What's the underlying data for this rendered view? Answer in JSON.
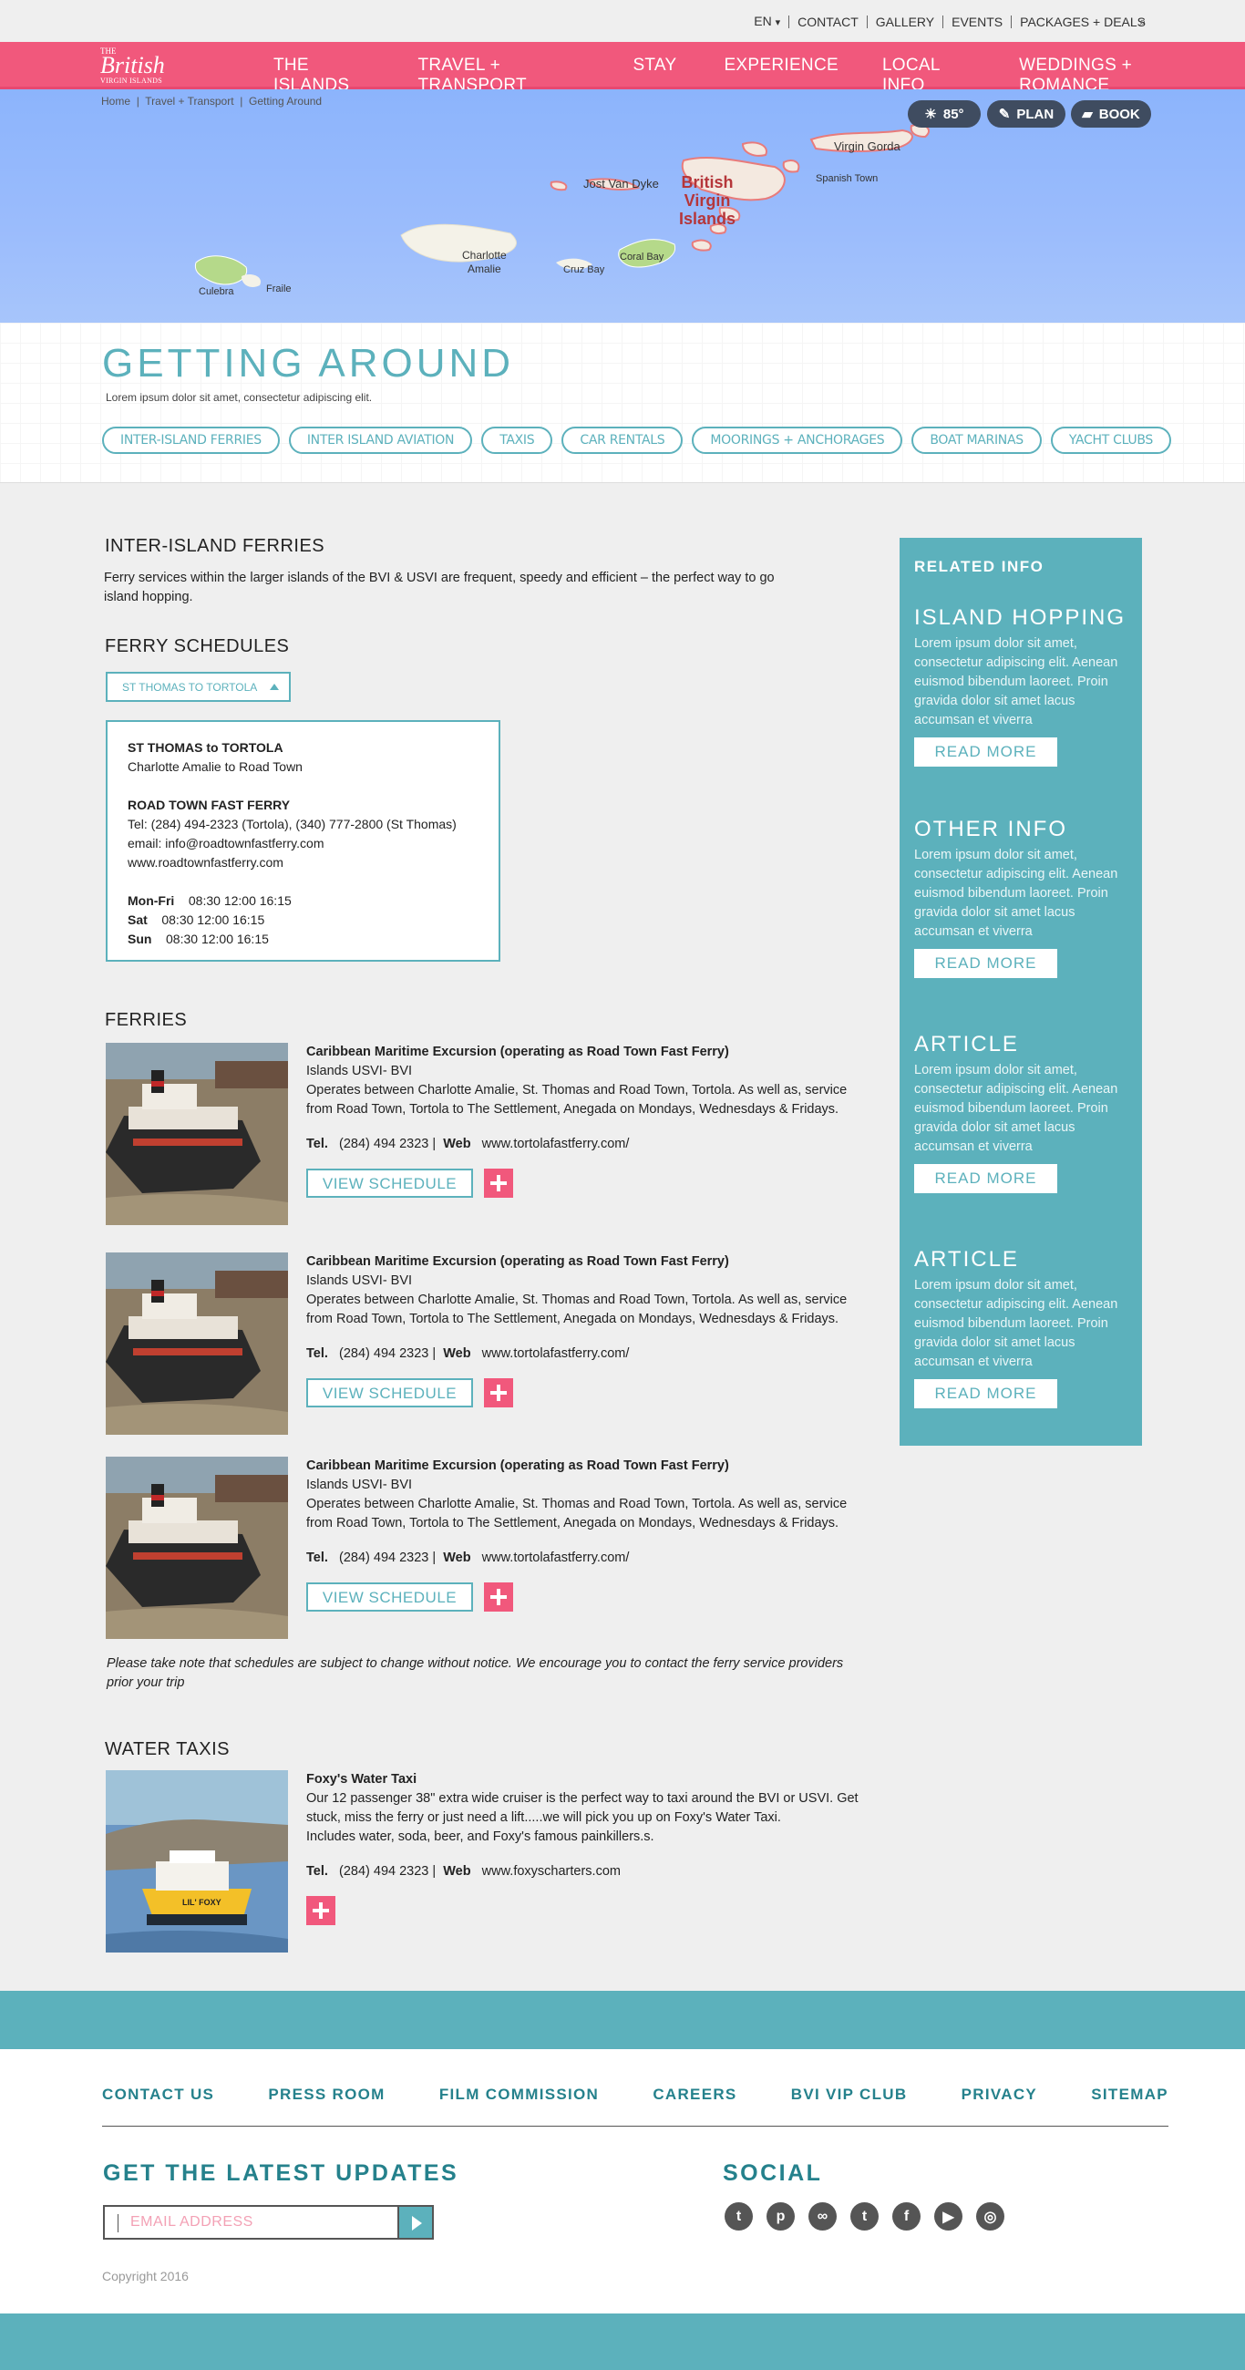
{
  "topbar": {
    "links": [
      "EN",
      "CONTACT",
      "GALLERY",
      "EVENTS",
      "PACKAGES + DEALS"
    ],
    "lang_caret": "▾",
    "search_icon": "search-icon",
    "search_glyph": "⌕"
  },
  "logo": {
    "small": "THE",
    "big": "British",
    "sub": "VIRGIN ISLANDS"
  },
  "nav": [
    "THE ISLANDS",
    "TRAVEL + TRANSPORT",
    "STAY",
    "EXPERIENCE",
    "LOCAL INFO",
    "WEDDINGS + ROMANCE"
  ],
  "breadcrumb": [
    "Home",
    "Travel + Transport",
    "Getting Around"
  ],
  "actions": {
    "weather": "85°",
    "plan": "PLAN",
    "book": "BOOK",
    "sun_glyph": "☀",
    "pen_glyph": "✎",
    "bag_glyph": "▰"
  },
  "map_labels": {
    "jost": "Jost Van Dyke",
    "bvi1": "British",
    "bvi2": "Virgin",
    "bvi3": "Islands",
    "gorda": "Virgin Gorda",
    "spanish": "Spanish Town",
    "charlotte1": "Charlotte",
    "charlotte2": "Amalie",
    "cruz": "Cruz Bay",
    "coral": "Coral Bay",
    "culebra": "Culebra",
    "fraile": "Fraile"
  },
  "hero": {
    "title": "GETTING AROUND",
    "lead": "Lorem ipsum dolor sit amet, consectetur adipiscing elit.",
    "tabs": [
      "INTER-ISLAND FERRIES",
      "INTER ISLAND AVIATION",
      "TAXIS",
      "CAR RENTALS",
      "MOORINGS + ANCHORAGES",
      "BOAT MARINAS",
      "YACHT CLUBS"
    ]
  },
  "ferries_intro": {
    "title": "INTER-ISLAND FERRIES",
    "text": "Ferry services within the larger islands of the BVI & USVI are frequent, speedy and efficient – the perfect way to go island hopping."
  },
  "schedules": {
    "title": "FERRY SCHEDULES",
    "dropdown": "ST THOMAS TO TORTOLA",
    "route_title": "ST THOMAS to TORTOLA",
    "route_sub": "Charlotte Amalie to Road Town",
    "company": "ROAD TOWN FAST FERRY",
    "tel": "Tel: (284) 494-2323 (Tortola), (340) 777-2800 (St Thomas)",
    "email": "email: info@roadtownfastferry.com",
    "web": "www.roadtownfastferry.com",
    "rows": [
      {
        "day": "Mon-Fri",
        "times": "08:30   12:00  16:15"
      },
      {
        "day": "Sat",
        "times": "08:30     12:00     16:15"
      },
      {
        "day": "Sun",
        "times": "08:30     12:00     16:15"
      }
    ]
  },
  "ferries": {
    "title": "FERRIES",
    "items": [
      {
        "name": "Caribbean Maritime Excursion (operating as Road Town Fast Ferry)",
        "region": "Islands USVI- BVI",
        "desc": "Operates between Charlotte Amalie, St. Thomas and Road Town, Tortola. As well as, service from Road Town, Tortola to The Settlement, Anegada on Mondays, Wednesdays & Fridays.",
        "tel_label": "Tel.",
        "tel": "(284) 494 2323 |",
        "web_label": "Web",
        "web": "www.tortolafastferry.com/",
        "btn": "VIEW SCHEDULE"
      },
      {
        "name": "Caribbean Maritime Excursion (operating as Road Town Fast Ferry)",
        "region": "Islands USVI- BVI",
        "desc": "Operates between Charlotte Amalie, St. Thomas and Road Town, Tortola. As well as, service from Road Town, Tortola to The Settlement, Anegada on Mondays, Wednesdays & Fridays.",
        "tel_label": "Tel.",
        "tel": "(284) 494 2323 |",
        "web_label": "Web",
        "web": "www.tortolafastferry.com/",
        "btn": "VIEW SCHEDULE"
      },
      {
        "name": "Caribbean Maritime Excursion (operating as Road Town Fast Ferry)",
        "region": "Islands USVI- BVI",
        "desc": "Operates between Charlotte Amalie, St. Thomas and Road Town, Tortola. As well as, service from Road Town, Tortola to The Settlement, Anegada on Mondays, Wednesdays & Fridays.",
        "tel_label": "Tel.",
        "tel": "(284) 494 2323 |",
        "web_label": "Web",
        "web": "www.tortolafastferry.com/",
        "btn": "VIEW SCHEDULE"
      }
    ],
    "note": "Please take note that schedules are subject to change without notice. We encourage you to contact the ferry service providers prior your trip"
  },
  "water_taxis": {
    "title": "WATER TAXIS",
    "name": "Foxy's Water Taxi",
    "desc": "Our 12 passenger 38\" extra wide cruiser is the perfect way to taxi around the BVI or USVI.  Get stuck, miss the ferry or just need a lift.....we will pick you up on Foxy's Water Taxi.",
    "desc2": "Includes water, soda, beer, and Foxy's famous painkillers.s.",
    "tel_label": "Tel.",
    "tel": "(284) 494 2323 |",
    "web_label": "Web",
    "web": "www.foxyscharters.com",
    "boat_name": "LIL' FOXY"
  },
  "sidebar": {
    "heading": "RELATED INFO",
    "lorem": "Lorem ipsum dolor sit amet, consectetur adipiscing elit. Aenean euismod bibendum laoreet. Proin gravida dolor sit amet lacus accumsan et viverra",
    "read_more": "READ MORE",
    "blocks": [
      "ISLAND HOPPING",
      "OTHER INFO",
      "ARTICLE",
      "ARTICLE"
    ]
  },
  "footer": {
    "links": [
      "CONTACT US",
      "PRESS ROOM",
      "FILM COMMISSION",
      "CAREERS",
      "BVI VIP CLUB",
      "PRIVACY",
      "SITEMAP"
    ],
    "updates": "GET THE LATEST UPDATES",
    "email_placeholder": "EMAIL ADDRESS",
    "social": "SOCIAL",
    "social_icons": [
      "twitter-icon",
      "pinterest-icon",
      "tripadvisor-icon",
      "tumblr-icon",
      "facebook-icon",
      "youtube-icon",
      "instagram-icon"
    ],
    "social_glyphs": [
      "t",
      "p",
      "∞",
      "t",
      "f",
      "▶",
      "◎"
    ],
    "copyright": "Copyright 2016"
  },
  "colors": {
    "pink": "#f1587c",
    "teal": "#5cb1bc",
    "dark_teal": "#25818c"
  }
}
